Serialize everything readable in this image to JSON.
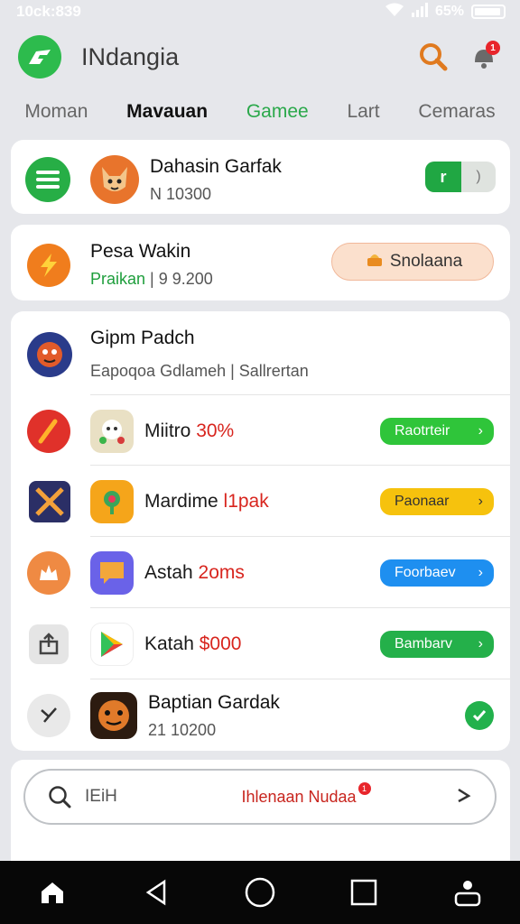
{
  "status_bar": {
    "time": "10ck:839",
    "battery_pct": "65%"
  },
  "header": {
    "title": "INdangia",
    "notification_count": "1"
  },
  "tabs": [
    {
      "label": "Moman"
    },
    {
      "label": "Mavauan"
    },
    {
      "label": "Gamee"
    },
    {
      "label": "Lart"
    },
    {
      "label": "Cemaras"
    }
  ],
  "card1": {
    "title": "Dahasin Garfak",
    "subtitle": "N 10300",
    "toggle_label": "r"
  },
  "card2": {
    "title": "Pesa Wakin",
    "sub_green": "Praikan",
    "sub_sep": "|",
    "sub_value": "9 9.200",
    "button_label": "Snolaana"
  },
  "list_header": {
    "title": "Gipm Padch",
    "subtitle": "Eapoqoa Gdlameh | Sallrertan"
  },
  "list_items": [
    {
      "name": "Miitro",
      "highlight": "30%",
      "button": "Raotrteir",
      "color": "#2fc53a"
    },
    {
      "name": "Mardime",
      "highlight": "l1pak",
      "button": "Paonaar",
      "color": "#f6c20d"
    },
    {
      "name": "Astah",
      "highlight": "2oms",
      "button": "Foorbaev",
      "color": "#1e8ff0"
    },
    {
      "name": "Katah",
      "highlight": "$000",
      "button": "Bambarv",
      "color": "#24b04a"
    }
  ],
  "last_item": {
    "title": "Baptian Gardak",
    "subtitle": "21 10200"
  },
  "search": {
    "placeholder": "IEiH",
    "center_text": "Ihlenaan Nudaa",
    "badge": "1"
  }
}
